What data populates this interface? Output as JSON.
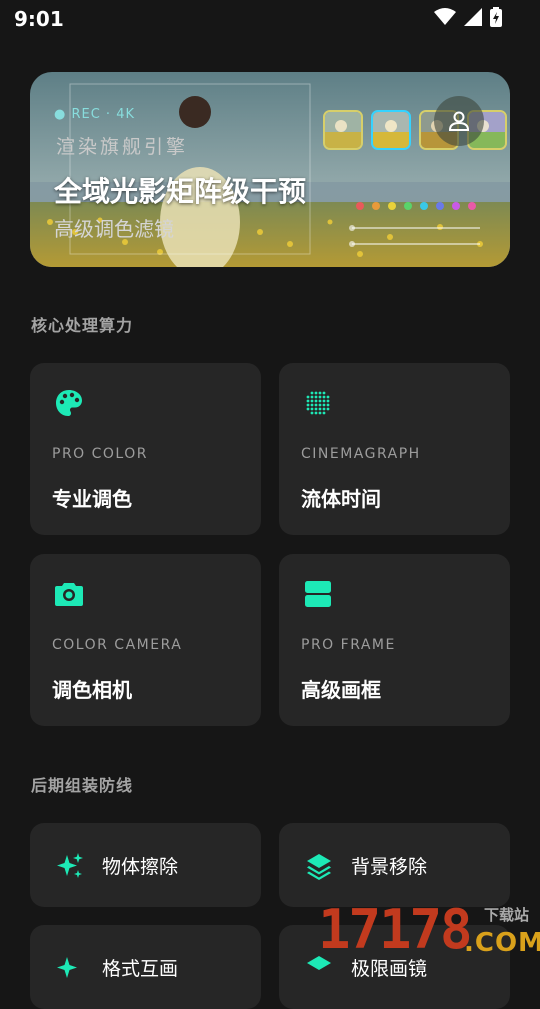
{
  "status": {
    "time": "9:01"
  },
  "hero": {
    "tag": "● REC · 4K",
    "engine": "渲染旗舰引擎",
    "title": "全域光影矩阵级干预",
    "subtitle": "高级调色滤镜"
  },
  "sections": {
    "core": "核心处理算力",
    "post": "后期组装防线"
  },
  "cards": [
    {
      "sub": "PRO COLOR",
      "name": "专业调色",
      "icon": "palette-icon"
    },
    {
      "sub": "CINEMAGRAPH",
      "name": "流体时间",
      "icon": "dots-grid-icon"
    },
    {
      "sub": "COLOR CAMERA",
      "name": "调色相机",
      "icon": "camera-icon"
    },
    {
      "sub": "PRO FRAME",
      "name": "高级画框",
      "icon": "frame-icon"
    }
  ],
  "tools": [
    {
      "label": "物体擦除",
      "icon": "sparkle-icon"
    },
    {
      "label": "背景移除",
      "icon": "layers-icon"
    },
    {
      "label": "格式互画",
      "icon": "sparkle-icon"
    },
    {
      "label": "极限画镜",
      "icon": "layers-icon"
    }
  ],
  "watermark": {
    "number": "17178",
    "site": "下载站",
    "domain": ".COM"
  },
  "colors": {
    "accent": "#1de9b6",
    "background": "#161616",
    "card": "#262626"
  }
}
